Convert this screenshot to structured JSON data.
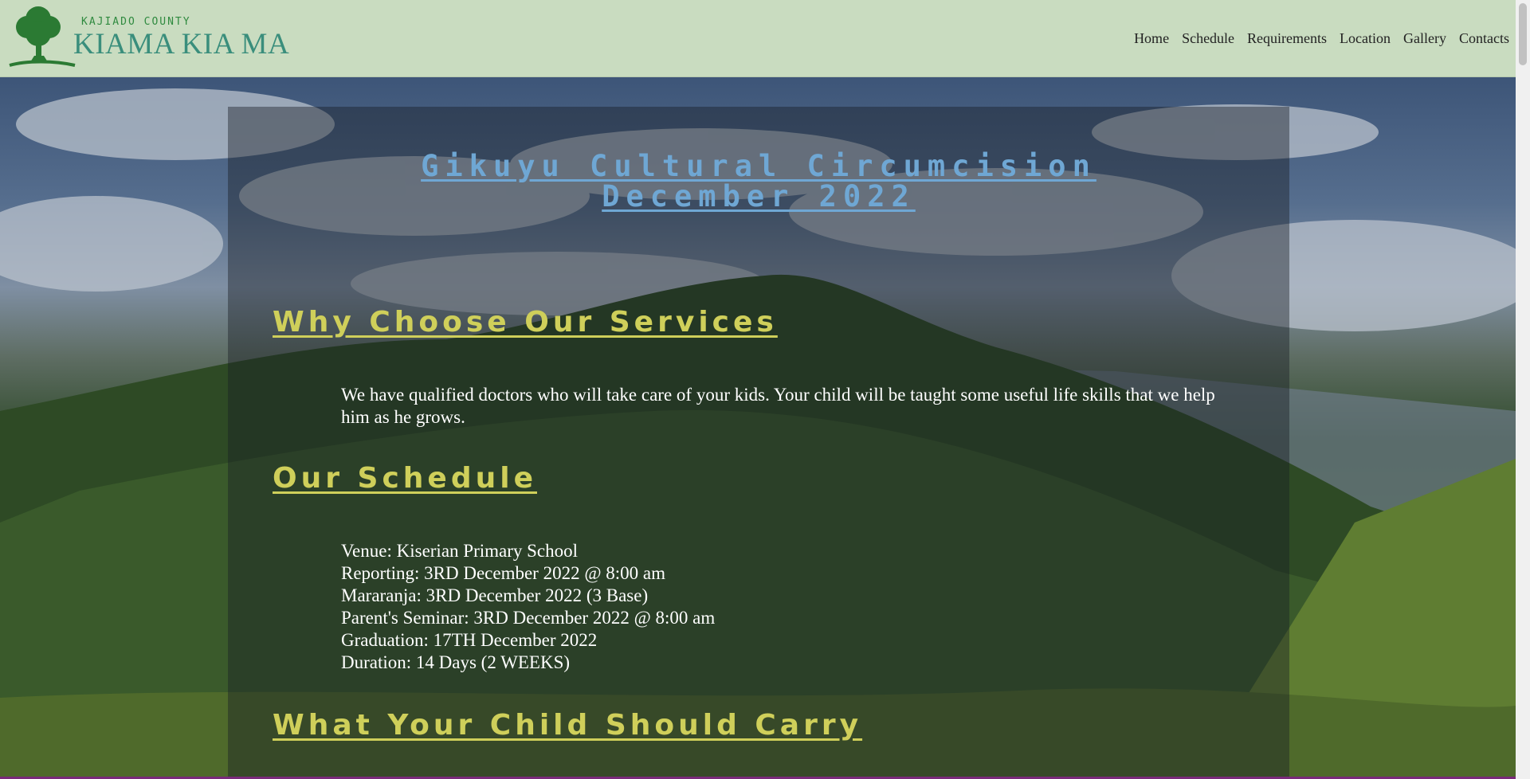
{
  "header": {
    "county": "KAJIADO COUNTY",
    "brand": "KIAMA KIA MA",
    "nav": [
      "Home",
      "Schedule",
      "Requirements",
      "Location",
      "Gallery",
      "Contacts"
    ]
  },
  "main": {
    "title_line1": "Gikuyu Cultural Circumcision",
    "title_line2": "December 2022",
    "why_title": "Why Choose Our Services",
    "why_text": "We have qualified doctors who will take care of your kids. Your child will be taught some useful life skills that we help him as he grows.",
    "schedule_title": "Our Schedule",
    "schedule": [
      "Venue: Kiserian Primary School",
      "Reporting: 3RD December 2022 @ 8:00 am",
      "Mararanja: 3RD December 2022 (3 Base)",
      "Parent's Seminar: 3RD December 2022 @ 8:00 am",
      "Graduation: 17TH December 2022",
      "Duration: 14 Days (2 WEEKS)"
    ],
    "carry_title": "What Your Child Should Carry"
  },
  "colors": {
    "header_bg": "#c9dcc0",
    "hero_title": "#6fa7d4",
    "section_title": "#cfcf5a",
    "brand": "#3a8e7c"
  },
  "icons": {
    "logo": "tree-logo-icon"
  }
}
